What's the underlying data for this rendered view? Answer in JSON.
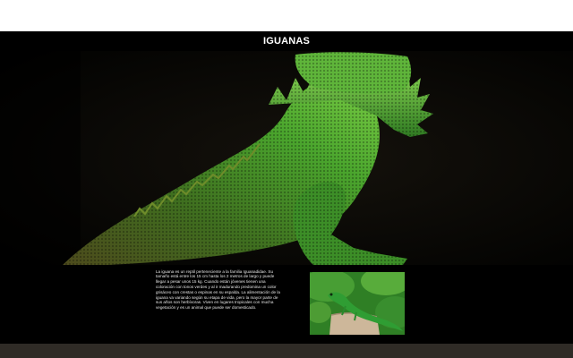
{
  "header": {
    "title": "IGUANAS"
  },
  "hero": {
    "image_alt": "iguana-hero-image"
  },
  "content": {
    "description": "La iguana es un reptil perteneciente a la familia Iguanadidae. Su tamaño está entre los 15 cm hasta los 2 metros de largo y puede llegar a pesar unos 15 kg. Cuando están jóvenes tienen una coloración con tonos verdes y al ir madurando predomina un color grisáceo con crestas o espinas en su espalda. La alimentación de la iguana va variando según su etapa de vida, pero la mayor parte de sus años son herbívoras. Viven en lugares tropicales con mucha vegetación y es un animal que puede ser domesticado.",
    "thumbnail_alt": "green-lizard-thumbnail"
  },
  "colors": {
    "background": "#000000",
    "header_text": "#ffffff",
    "body_text": "#e6e6e6",
    "iguana_green": "#3aa02a",
    "footer": "#2f2b26"
  }
}
